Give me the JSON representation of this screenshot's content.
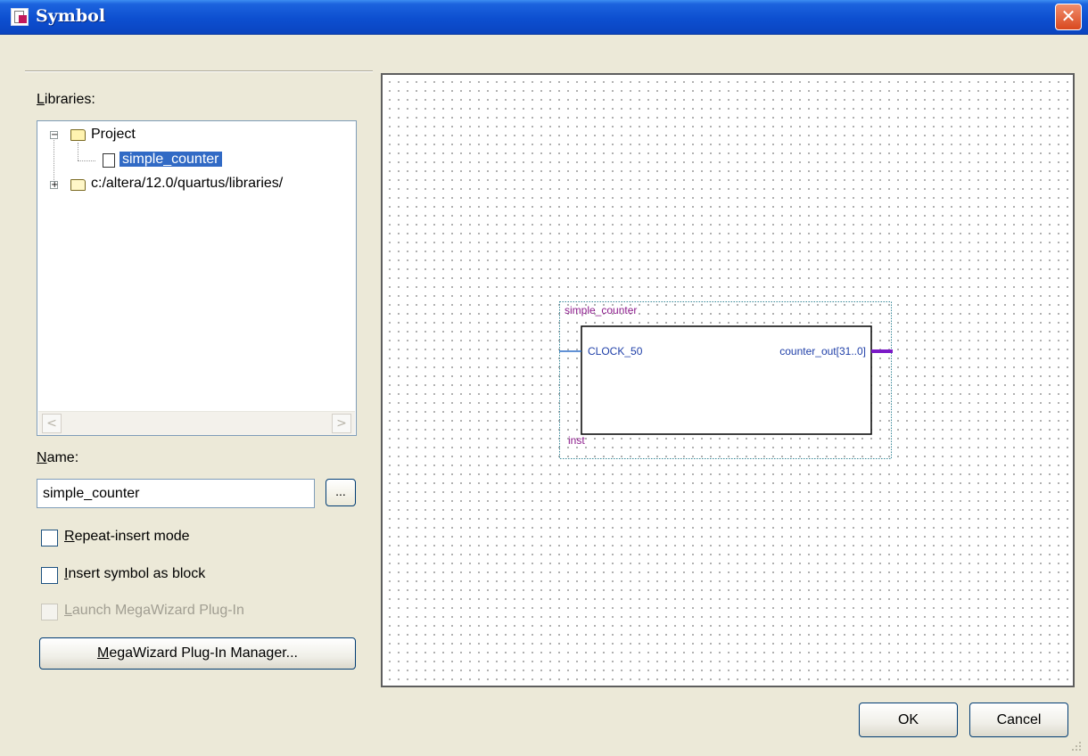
{
  "window": {
    "title": "Symbol",
    "close_glyph": "✕"
  },
  "libraries": {
    "label": "Libraries:",
    "label_mnemonic": "L",
    "label_rest": "ibraries:",
    "tree": [
      {
        "label": "Project",
        "expander": "−",
        "icon": "folder-open-icon"
      },
      {
        "label": "simple_counter",
        "icon": "symbol-icon",
        "selected": true
      },
      {
        "label": "c:/altera/12.0/quartus/libraries/",
        "expander": "+",
        "icon": "folder-icon"
      }
    ],
    "scroll_left": "<",
    "scroll_right": ">"
  },
  "name": {
    "label": "Name:",
    "label_mnemonic": "N",
    "label_rest": "ame:",
    "value": "simple_counter",
    "browse_label": "..."
  },
  "options": {
    "repeat_insert": {
      "label": "Repeat-insert mode",
      "mnemonic": "R",
      "rest": "epeat-insert mode",
      "checked": false
    },
    "insert_as_block": {
      "label": "Insert symbol as block",
      "mnemonic": "I",
      "rest": "nsert symbol as block",
      "checked": false
    },
    "launch_megawizard": {
      "label": "Launch MegaWizard Plug-In",
      "mnemonic": "L",
      "rest": "aunch MegaWizard Plug-In",
      "checked": false,
      "enabled": false
    }
  },
  "megawizard_button": {
    "label": "MegaWizard Plug-In Manager...",
    "mnemonic": "M",
    "rest": "egaWizard Plug-In Manager..."
  },
  "preview": {
    "symbol_name": "simple_counter",
    "instance_name": "inst",
    "input_port": "CLOCK_50",
    "output_port": "counter_out[31..0]",
    "colors": {
      "name_text": "#8b1a8b",
      "port_text": "#1f3fa8",
      "input_wire": "#2f6fc8",
      "output_bus": "#7b19c7",
      "boundary": "#3a8a9a"
    }
  },
  "buttons": {
    "ok": "OK",
    "cancel": "Cancel"
  }
}
